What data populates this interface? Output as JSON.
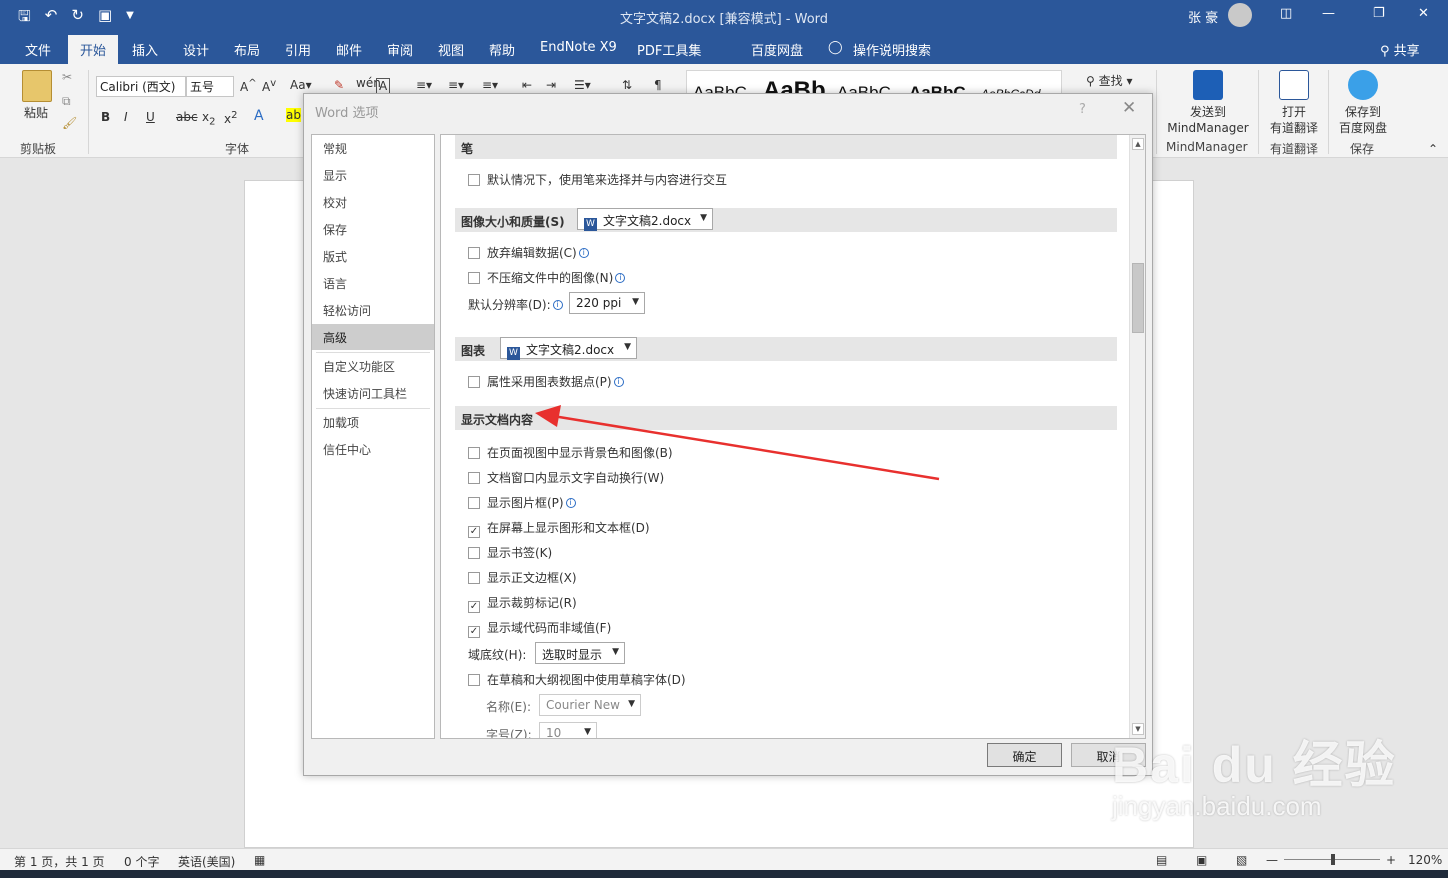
{
  "window": {
    "title": "文字文稿2.docx [兼容模式] - Word",
    "user": "张 豪",
    "share": "共享"
  },
  "tabs": [
    "文件",
    "开始",
    "插入",
    "设计",
    "布局",
    "引用",
    "邮件",
    "审阅",
    "视图",
    "帮助",
    "EndNote X9",
    "PDF工具集",
    "百度网盘",
    "操作说明搜索"
  ],
  "ribbon": {
    "font_name": "Calibri (西文)",
    "font_size": "五号",
    "paste": "粘贴",
    "clipboard_label": "剪贴板",
    "font_label": "字体",
    "find": "查找",
    "styles": [
      "AaBbC",
      "AaBb",
      "AaBbC",
      "AaBbC",
      "AaBbCcDd"
    ],
    "mindmanager": {
      "line1": "发送到",
      "line2": "MindManager",
      "group": "MindManager"
    },
    "youdao": {
      "line1": "打开",
      "line2": "有道翻译",
      "group": "有道翻译"
    },
    "baidu": {
      "line1": "保存到",
      "line2": "百度网盘",
      "group": "保存"
    }
  },
  "dialog": {
    "title": "Word 选项",
    "help": "?",
    "nav": [
      "常规",
      "显示",
      "校对",
      "保存",
      "版式",
      "语言",
      "轻松访问",
      "高级",
      "自定义功能区",
      "快速访问工具栏",
      "加载项",
      "信任中心"
    ],
    "active_nav": "高级",
    "sections": {
      "pen": "笔",
      "image": "图像大小和质量(S)",
      "chart": "图表",
      "display": "显示文档内容"
    },
    "options": {
      "pen_interact": "默认情况下，使用笔来选择并与内容进行交互",
      "discard_edit": "放弃编辑数据(C)",
      "no_compress": "不压缩文件中的图像(N)",
      "resolution_label": "默认分辨率(D):",
      "chart_props": "属性采用图表数据点(P)",
      "bg_colors": "在页面视图中显示背景色和图像(B)",
      "wrap_text": "文档窗口内显示文字自动换行(W)",
      "placeholders": "显示图片框(P)",
      "drawings": "在屏幕上显示图形和文本框(D)",
      "bookmarks": "显示书签(K)",
      "text_bounds": "显示正文边框(X)",
      "crop_marks": "显示裁剪标记(R)",
      "field_codes": "显示域代码而非域值(F)",
      "field_shading_label": "域底纹(H):",
      "draft_font": "在草稿和大纲视图中使用草稿字体(D)",
      "name_label": "名称(E):",
      "size_label": "字号(Z):"
    },
    "checked": {
      "drawings": true,
      "crop_marks": true,
      "field_codes": true
    },
    "dropdowns": {
      "image_doc": "文字文稿2.docx",
      "resolution": "220 ppi",
      "chart_doc": "文字文稿2.docx",
      "field_shading": "选取时显示",
      "draft_font_name": "Courier New",
      "draft_font_size": "10"
    },
    "ok": "确定",
    "cancel": "取消"
  },
  "status": {
    "page": "第 1 页，共 1 页",
    "words": "0 个字",
    "language": "英语(美国)",
    "zoom": "120%"
  },
  "watermark": {
    "brand": "Bai du 经验",
    "url": "jingyan.baidu.com"
  },
  "colors": {
    "brand": "#2b579a",
    "arrow": "#e8302e"
  }
}
